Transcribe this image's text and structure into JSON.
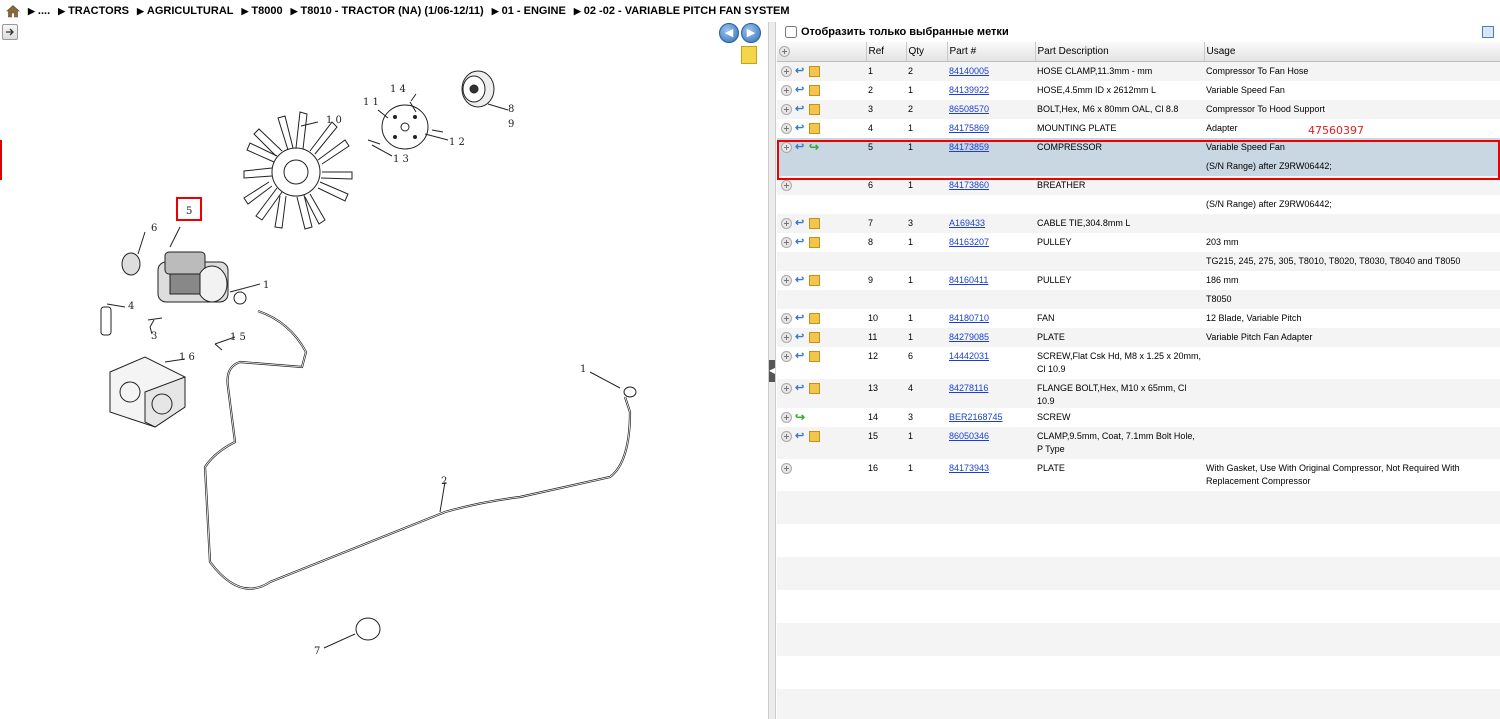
{
  "breadcrumb": {
    "items": [
      "....",
      "TRACTORS",
      "AGRICULTURAL",
      "T8000",
      "T8010 - TRACTOR (NA) (1/06-12/11)",
      "01 - ENGINE",
      "02 -02 - VARIABLE PITCH FAN SYSTEM"
    ]
  },
  "toolbar": {
    "back_icon": "back-arrow-icon",
    "forward_icon": "forward-arrow-icon"
  },
  "filter": {
    "label": "Отобразить только выбранные метки",
    "checked": false
  },
  "table": {
    "headers": {
      "ref": "Ref",
      "qty": "Qty",
      "part": "Part #",
      "desc": "Part Description",
      "usage": "Usage"
    },
    "rows": [
      {
        "ref": "1",
        "qty": "2",
        "part": "84140005",
        "desc": "HOSE CLAMP,11.3mm - mm",
        "usage": "Compressor To Fan Hose",
        "icons": [
          "plus",
          "arrow",
          "box"
        ]
      },
      {
        "ref": "2",
        "qty": "1",
        "part": "84139922",
        "desc": "HOSE,4.5mm ID x 2612mm L",
        "usage": "Variable Speed Fan",
        "icons": [
          "plus",
          "arrow",
          "box"
        ]
      },
      {
        "ref": "3",
        "qty": "2",
        "part": "86508570",
        "desc": "BOLT,Hex, M6 x 80mm OAL, Cl 8.8",
        "usage": "Compressor To Hood Support",
        "icons": [
          "plus",
          "arrow",
          "box"
        ]
      },
      {
        "ref": "4",
        "qty": "1",
        "part": "84175869",
        "desc": "MOUNTING PLATE",
        "usage": "Adapter",
        "icons": [
          "plus",
          "arrow",
          "box"
        ]
      },
      {
        "ref": "5",
        "qty": "1",
        "part": "84173859",
        "desc": "COMPRESSOR",
        "usage": "Variable Speed Fan",
        "usage2": "(S/N Range) after Z9RW06442;",
        "icons": [
          "plus",
          "arrow",
          "green"
        ],
        "selected": true
      },
      {
        "ref": "6",
        "qty": "1",
        "part": "84173860",
        "desc": "BREATHER",
        "usage": "",
        "usage2": "(S/N Range) after Z9RW06442;",
        "icons": [
          "plus"
        ]
      },
      {
        "ref": "7",
        "qty": "3",
        "part": "A169433",
        "desc": "CABLE TIE,304.8mm L",
        "usage": "",
        "icons": [
          "plus",
          "arrow",
          "box"
        ]
      },
      {
        "ref": "8",
        "qty": "1",
        "part": "84163207",
        "desc": "PULLEY",
        "usage": "203 mm",
        "usage2": "TG215, 245, 275, 305, T8010, T8020, T8030, T8040 and T8050",
        "icons": [
          "plus",
          "arrow",
          "box"
        ]
      },
      {
        "ref": "9",
        "qty": "1",
        "part": "84160411",
        "desc": "PULLEY",
        "usage": "186 mm",
        "usage2": "T8050",
        "icons": [
          "plus",
          "arrow",
          "box"
        ]
      },
      {
        "ref": "10",
        "qty": "1",
        "part": "84180710",
        "desc": "FAN",
        "usage": "12 Blade, Variable Pitch",
        "icons": [
          "plus",
          "arrow",
          "box"
        ]
      },
      {
        "ref": "11",
        "qty": "1",
        "part": "84279085",
        "desc": "PLATE",
        "usage": "Variable Pitch Fan Adapter",
        "icons": [
          "plus",
          "arrow",
          "box"
        ]
      },
      {
        "ref": "12",
        "qty": "6",
        "part": "14442031",
        "desc": "SCREW,Flat Csk Hd, M8 x 1.25 x 20mm, Cl 10.9",
        "usage": "",
        "icons": [
          "plus",
          "arrow",
          "box"
        ]
      },
      {
        "ref": "13",
        "qty": "4",
        "part": "84278116",
        "desc": "FLANGE BOLT,Hex, M10 x 65mm, Cl 10.9",
        "usage": "",
        "icons": [
          "plus",
          "arrow",
          "box"
        ]
      },
      {
        "ref": "14",
        "qty": "3",
        "part": "BER2168745",
        "desc": "SCREW",
        "usage": "",
        "icons": [
          "plus",
          "green"
        ]
      },
      {
        "ref": "15",
        "qty": "1",
        "part": "86050346",
        "desc": "CLAMP,9.5mm, Coat, 7.1mm Bolt Hole, P Type",
        "usage": "",
        "icons": [
          "plus",
          "arrow",
          "box"
        ]
      },
      {
        "ref": "16",
        "qty": "1",
        "part": "84173943",
        "desc": "PLATE",
        "usage": "With Gasket, Use With Original Compressor, Not Required With Replacement Compressor",
        "icons": [
          "plus"
        ]
      }
    ]
  },
  "overlay_number": "47560397",
  "diagram": {
    "callouts": [
      "1",
      "2",
      "3",
      "4",
      "5",
      "6",
      "7",
      "8",
      "9",
      "10",
      "11",
      "12",
      "13",
      "14",
      "15",
      "16",
      "1"
    ]
  }
}
